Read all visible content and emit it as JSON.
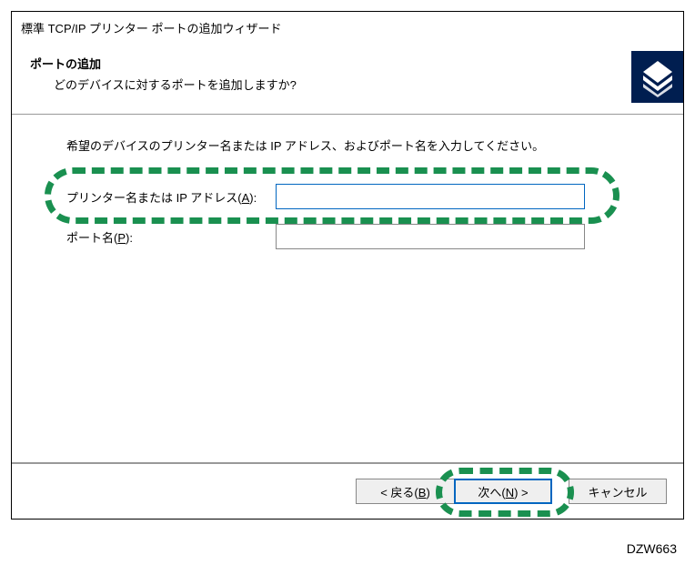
{
  "wizard": {
    "title": "標準 TCP/IP プリンター ポートの追加ウィザード",
    "header_title": "ポートの追加",
    "header_sub": "どのデバイスに対するポートを追加しますか?",
    "instruction": "希望のデバイスのプリンター名または IP アドレス、およびポート名を入力してください。",
    "fields": {
      "address_label_pre": "プリンター名または IP アドレス(",
      "address_label_u": "A",
      "address_label_post": "):",
      "address_value": "",
      "port_label_pre": "ポート名(",
      "port_label_u": "P",
      "port_label_post": "):",
      "port_value": ""
    },
    "buttons": {
      "back_pre": "< 戻る(",
      "back_u": "B",
      "back_post": ")",
      "next_pre": "次へ(",
      "next_u": "N",
      "next_post": ") >",
      "cancel": "キャンセル"
    }
  },
  "image_id": "DZW663"
}
